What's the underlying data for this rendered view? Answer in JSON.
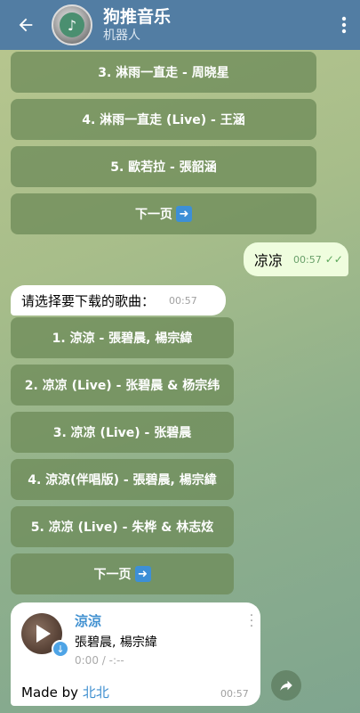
{
  "header": {
    "title": "狗推音乐",
    "subtitle": "机器人"
  },
  "top_buttons": [
    {
      "label": "3. 淋雨一直走 - 周晓星"
    },
    {
      "label": "4. 淋雨一直走 (Live) - 王涵"
    },
    {
      "label": "5. 歐若拉 - 張韶涵"
    },
    {
      "label": "下一页"
    }
  ],
  "outgoing_message": {
    "text": "凉凉",
    "time": "00:57"
  },
  "incoming_message": {
    "text": "请选择要下载的歌曲：",
    "time": "00:57"
  },
  "song_buttons": [
    {
      "label": "1. 涼涼 - 張碧晨, 楊宗緯"
    },
    {
      "label": "2. 凉凉 (Live) - 张碧晨 & 杨宗纬"
    },
    {
      "label": "3. 凉凉 (Live) - 张碧晨"
    },
    {
      "label": "4. 涼涼(伴唱版) - 張碧晨, 楊宗緯"
    },
    {
      "label": "5. 凉凉 (Live) - 朱桦 & 林志炫"
    },
    {
      "label": "下一页"
    }
  ],
  "audio": {
    "title": "涼涼",
    "artist": "張碧晨, 楊宗緯",
    "duration": "0:00 / -:--",
    "made_by_prefix": "Made by ",
    "made_by_link": "北北",
    "time": "00:57"
  },
  "colors": {
    "header": "#527da3",
    "button": "#6e8c5a",
    "outgoing_bubble": "#effdde",
    "link": "#3e8fd0"
  }
}
